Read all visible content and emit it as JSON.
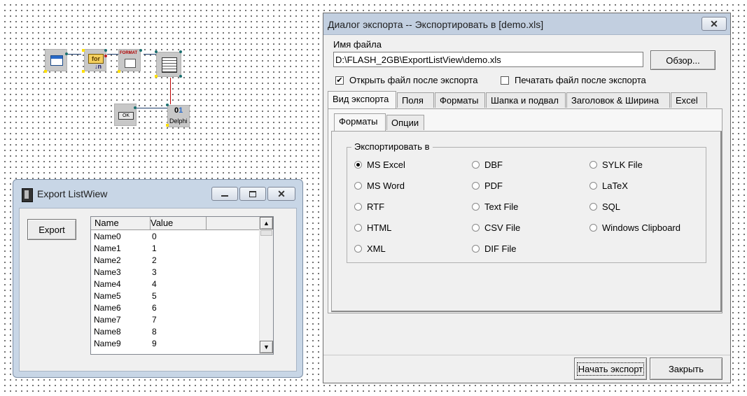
{
  "export_window": {
    "title": "Export ListWiew",
    "export_button": "Export",
    "columns": [
      "Name",
      "Value"
    ],
    "rows": [
      {
        "name": "Name0",
        "value": "0"
      },
      {
        "name": "Name1",
        "value": "1"
      },
      {
        "name": "Name2",
        "value": "2"
      },
      {
        "name": "Name3",
        "value": "3"
      },
      {
        "name": "Name4",
        "value": "4"
      },
      {
        "name": "Name5",
        "value": "5"
      },
      {
        "name": "Name6",
        "value": "6"
      },
      {
        "name": "Name7",
        "value": "7"
      },
      {
        "name": "Name8",
        "value": "8"
      },
      {
        "name": "Name9",
        "value": "9"
      }
    ]
  },
  "canvas": {
    "format_label": "FORMAT",
    "for_label": "for",
    "ok_label": "OK",
    "delphi_label": "Delphi"
  },
  "dialog": {
    "title": "Диалог экспорта -- Экспортировать в [demo.xls]",
    "filename_label": "Имя файла",
    "filename_value": "D:\\FLASH_2GB\\ExportListView\\demo.xls",
    "browse_button": "Обзор...",
    "open_after_label": "Открыть файл после экспорта",
    "open_after_checked": true,
    "print_after_label": "Печатать файл после экспорта",
    "print_after_checked": false,
    "tabs": [
      "Вид экспорта",
      "Поля",
      "Форматы",
      "Шапка и подвал",
      "Заголовок & Ширина",
      "Excel"
    ],
    "subtabs": [
      "Форматы",
      "Опции"
    ],
    "group_label": "Экспортировать в",
    "formats": [
      [
        "MS Excel",
        "DBF",
        "SYLK File"
      ],
      [
        "MS Word",
        "PDF",
        "LaTeX"
      ],
      [
        "RTF",
        "Text File",
        "SQL"
      ],
      [
        "HTML",
        "CSV File",
        "Windows Clipboard"
      ],
      [
        "XML",
        "DIF File"
      ]
    ],
    "selected_format": "MS Excel",
    "start_button": "Начать экспорт",
    "close_button": "Закрыть"
  }
}
